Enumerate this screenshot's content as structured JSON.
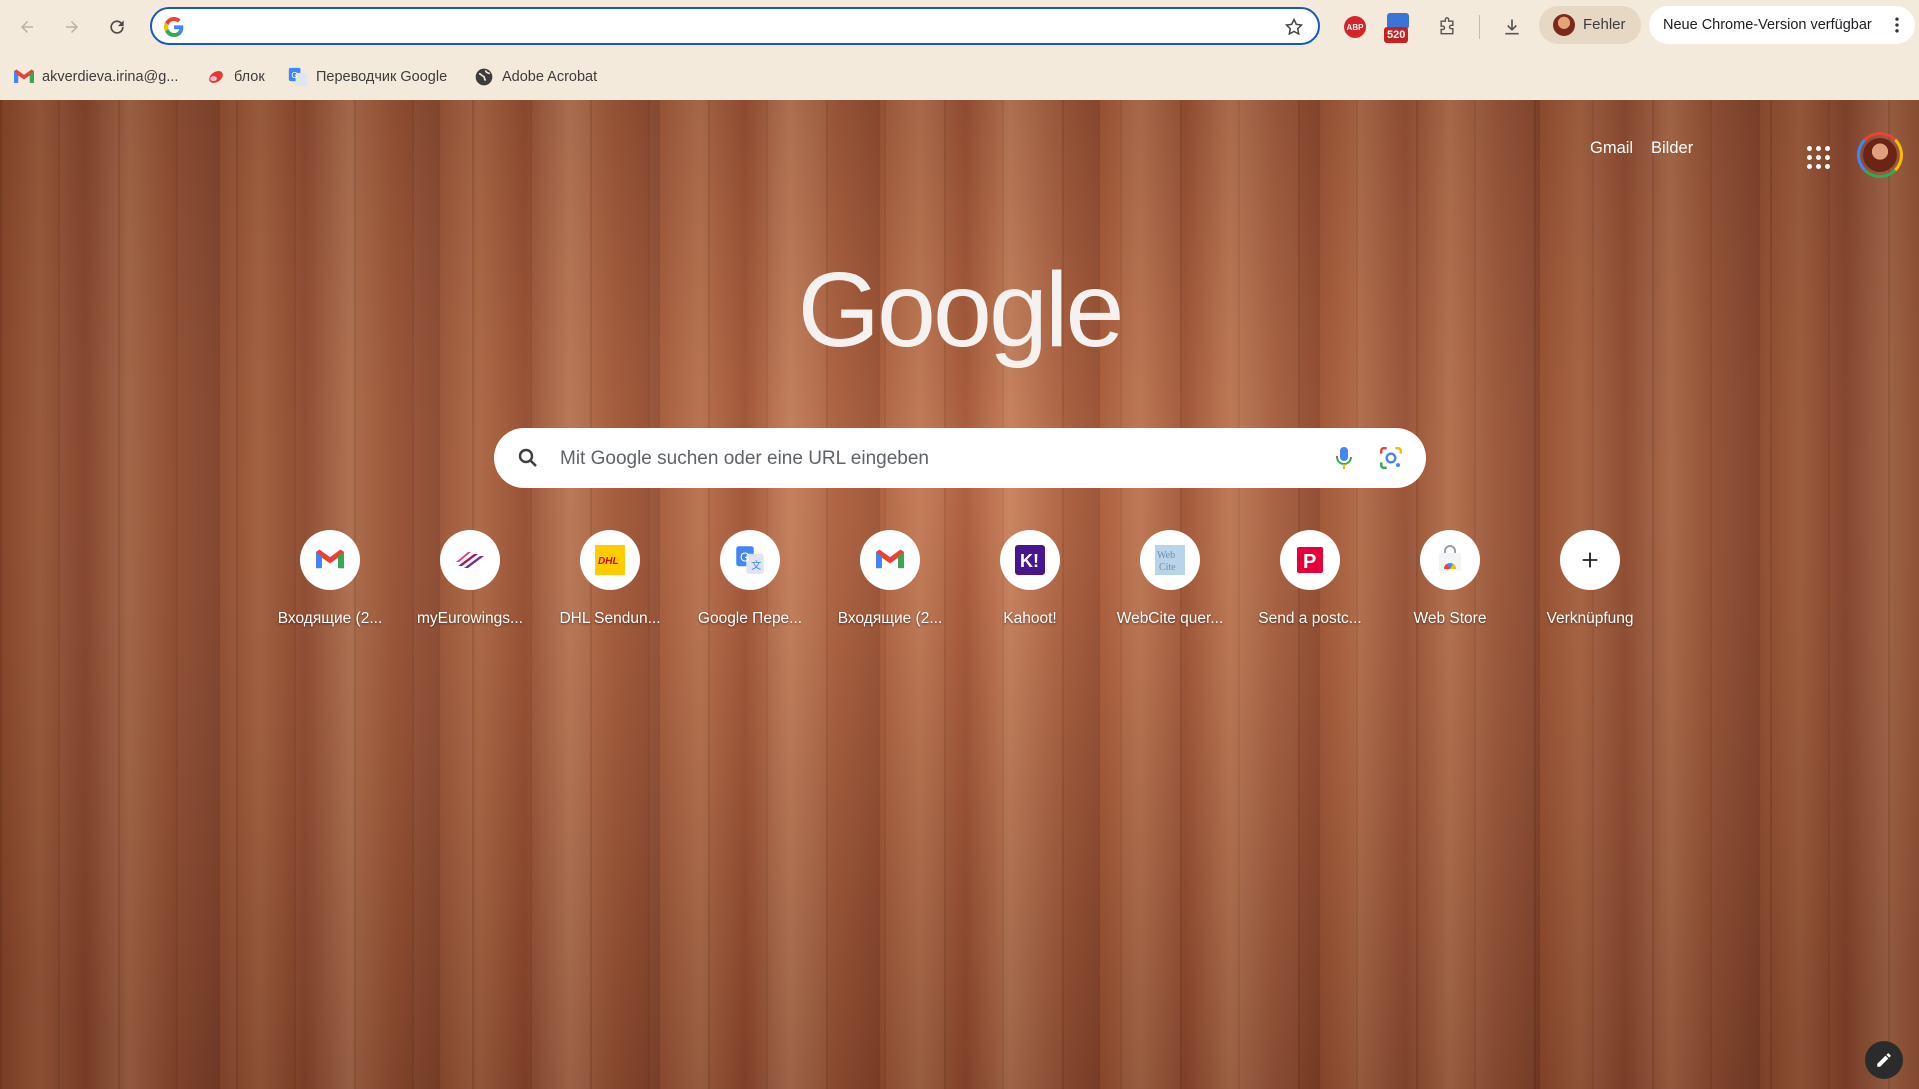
{
  "toolbar": {
    "address_value": "",
    "profile_label": "Fehler",
    "update_label": "Neue Chrome-Version verfügbar",
    "abp_label": "ABP",
    "ext_badge": "520"
  },
  "bookmarks": [
    {
      "label": "akverdieva.irina@g...",
      "icon": "gmail-icon"
    },
    {
      "label": "блок",
      "icon": "bookmark-icon"
    },
    {
      "label": "Переводчик Google",
      "icon": "translate-icon"
    },
    {
      "label": "Adobe Acrobat",
      "icon": "globe-icon"
    }
  ],
  "ntp": {
    "top_links": {
      "gmail": "Gmail",
      "images": "Bilder"
    },
    "logo": "Google",
    "search_placeholder": "Mit Google suchen oder eine URL eingeben",
    "shortcuts": [
      {
        "label": "Входящие (2...",
        "icon": "gmail-icon"
      },
      {
        "label": "myEurowings...",
        "icon": "eurowings-icon"
      },
      {
        "label": "DHL Sendun...",
        "icon": "dhl-icon"
      },
      {
        "label": "Google Пере...",
        "icon": "translate-icon"
      },
      {
        "label": "Входящие (2...",
        "icon": "gmail-icon"
      },
      {
        "label": "Kahoot!",
        "icon": "kahoot-icon"
      },
      {
        "label": "WebCite quer...",
        "icon": "webcite-icon"
      },
      {
        "label": "Send a postc...",
        "icon": "postcard-icon"
      },
      {
        "label": "Web Store",
        "icon": "webstore-icon"
      },
      {
        "label": "Verknüpfung",
        "icon": "plus-icon"
      }
    ]
  }
}
